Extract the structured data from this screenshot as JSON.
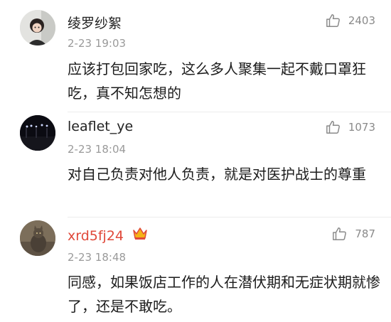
{
  "comments": [
    {
      "username": "绫罗纱絮",
      "time": "2-23 19:03",
      "likes": "2403",
      "text": "应该打包回家吃，这么多人聚集一起不戴口罩狂吃，真不知怎想的"
    },
    {
      "username": "leaflet_ye",
      "time": "2-23 18:04",
      "likes": "1073",
      "text": "对自己负责对他人负责，就是对医护战士的尊重"
    },
    {
      "username": "xrd5fj24",
      "time": "2-23 18:48",
      "likes": "787",
      "text": "同感，如果饭店工作的人在潜伏期和无症状期就惨了，还是不敢吃。",
      "badge": "crown-icon"
    }
  ],
  "colors": {
    "name": "#222222",
    "meta": "#9a9a9a",
    "text": "#1c1c1c",
    "vip_badge": "#e8a317"
  }
}
